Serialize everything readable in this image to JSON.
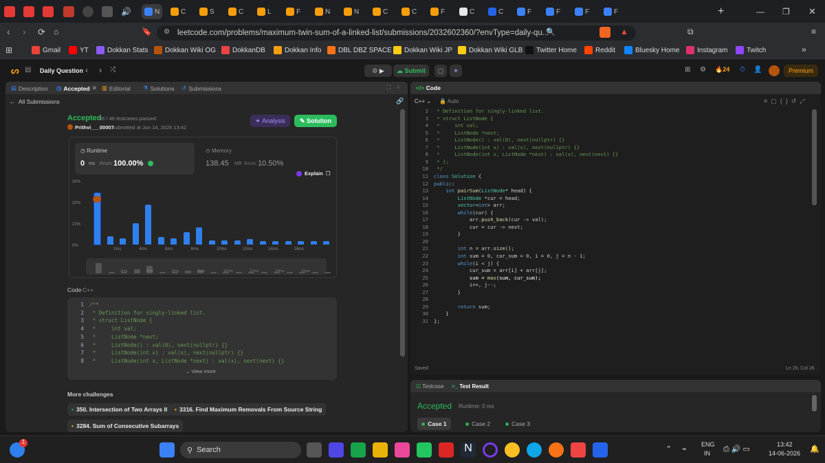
{
  "browser": {
    "tabs": [
      "N",
      "C",
      "S",
      "C",
      "L",
      "F",
      "N",
      "N",
      "C",
      "C",
      "F",
      "C",
      "C",
      "F",
      "F",
      "F",
      "F"
    ],
    "url": "leetcode.com/problems/maximum-twin-sum-of-a-linked-list/submissions/2032602360/?envType=daily-qu...",
    "bookmarks": [
      "Gmail",
      "YT",
      "Dokkan Stats",
      "Dokkan Wiki OG",
      "DokkanDB",
      "Dokkan Info",
      "DBL DBZ SPACE",
      "Dokkan Wiki JP",
      "Dokkan Wiki GLB",
      "Twitter Home",
      "Reddit",
      "Bluesky Home",
      "Instagram",
      "Twitch"
    ]
  },
  "nav": {
    "daily": "Daily Question",
    "submit": "Submit",
    "streak": "24",
    "premium": "Premium"
  },
  "left": {
    "tabs": [
      "Description",
      "Accepted",
      "Editorial",
      "Solutions",
      "Submissions"
    ],
    "back": "All Submissions",
    "status": "Accepted",
    "passed": "46 / 46 testcases passed",
    "user": "Prithvi___00007",
    "submitted": "submitted at Jun 14, 2026 13:42",
    "analysis": "Analysis",
    "solution": "Solution",
    "runtime_label": "Runtime",
    "runtime_val": "0",
    "runtime_unit": "ms",
    "beats": "Beats",
    "runtime_pct": "100.00%",
    "memory_label": "Memory",
    "memory_val": "138.45",
    "memory_unit": "MB",
    "memory_pct": "10.50%",
    "explain": "Explain",
    "code_label": "Code",
    "code_lang": "C++",
    "view_more": "View more",
    "more": "More challenges",
    "challenges": [
      "350. Intersection of Two Arrays II",
      "3316. Find Maximum Removals From Source String",
      "3284. Sum of Consecutive Subarrays"
    ]
  },
  "chart_data": {
    "type": "bar",
    "y_ticks": [
      "30%",
      "20%",
      "10%",
      "0%"
    ],
    "x_ticks": [
      "2ms",
      "4ms",
      "6ms",
      "8ms",
      "10ms",
      "12ms",
      "14ms",
      "16ms"
    ],
    "values": [
      24.5,
      4,
      3,
      10,
      19,
      3.5,
      3,
      6,
      8,
      2,
      2,
      2,
      2.5,
      1.5,
      1.5,
      1.5,
      1.5,
      1.5,
      1.5
    ],
    "highlight_index": 0
  },
  "right": {
    "title": "Code",
    "lang": "C++",
    "auto": "Auto",
    "saved": "Saved",
    "pos": "Ln 25, Col 26"
  },
  "code_right": [
    [
      "2",
      " * Definition for singly-linked list."
    ],
    [
      "3",
      " * struct ListNode {"
    ],
    [
      "4",
      " *     int val;"
    ],
    [
      "5",
      " *     ListNode *next;"
    ],
    [
      "6",
      " *     ListNode() : val(0), next(nullptr) {}"
    ],
    [
      "7",
      " *     ListNode(int x) : val(x), next(nullptr) {}"
    ],
    [
      "8",
      " *     ListNode(int x, ListNode *next) : val(x), next(next) {}"
    ],
    [
      "9",
      " * };"
    ],
    [
      "10",
      " */"
    ],
    [
      "11",
      "class Solution {"
    ],
    [
      "12",
      "public:"
    ],
    [
      "13",
      "    int pairSum(ListNode* head) {"
    ],
    [
      "14",
      "        ListNode *cur = head;"
    ],
    [
      "15",
      "        vector<int> arr;"
    ],
    [
      "16",
      "        while(cur) {"
    ],
    [
      "17",
      "            arr.push_back(cur -> val);"
    ],
    [
      "18",
      "            cur = cur -> next;"
    ],
    [
      "19",
      "        }"
    ],
    [
      "20",
      ""
    ],
    [
      "21",
      "        int n = arr.size();"
    ],
    [
      "22",
      "        int sum = 0, cur_sum = 0, i = 0, j = n - 1;"
    ],
    [
      "23",
      "        while(i < j) {"
    ],
    [
      "24",
      "            cur_sum = arr[i] + arr[j];"
    ],
    [
      "25",
      "            sum = max(sum, cur_sum);"
    ],
    [
      "26",
      "            i++, j--;"
    ],
    [
      "27",
      "        }"
    ],
    [
      "28",
      ""
    ],
    [
      "29",
      "        return sum;"
    ],
    [
      "30",
      "    }"
    ],
    [
      "31",
      "};"
    ]
  ],
  "code_left": [
    [
      "1",
      "/**"
    ],
    [
      "2",
      " * Definition for singly-linked list."
    ],
    [
      "3",
      " * struct ListNode {"
    ],
    [
      "4",
      " *     int val;"
    ],
    [
      "5",
      " *     ListNode *next;"
    ],
    [
      "6",
      " *     ListNode() : val(0), next(nullptr) {}"
    ],
    [
      "7",
      " *     ListNode(int x) : val(x), next(nullptr) {}"
    ],
    [
      "8",
      " *     ListNode(int x, ListNode *next) : val(x), next(next) {}"
    ]
  ],
  "test": {
    "tab1": "Testcase",
    "tab2": "Test Result",
    "status": "Accepted",
    "runtime": "Runtime: 0 ms",
    "cases": [
      "Case 1",
      "Case 2",
      "Case 3"
    ]
  },
  "taskbar": {
    "search": "Search",
    "lang1": "ENG",
    "lang2": "IN",
    "time": "13:42",
    "date": "14-06-2026",
    "badge": "1"
  }
}
